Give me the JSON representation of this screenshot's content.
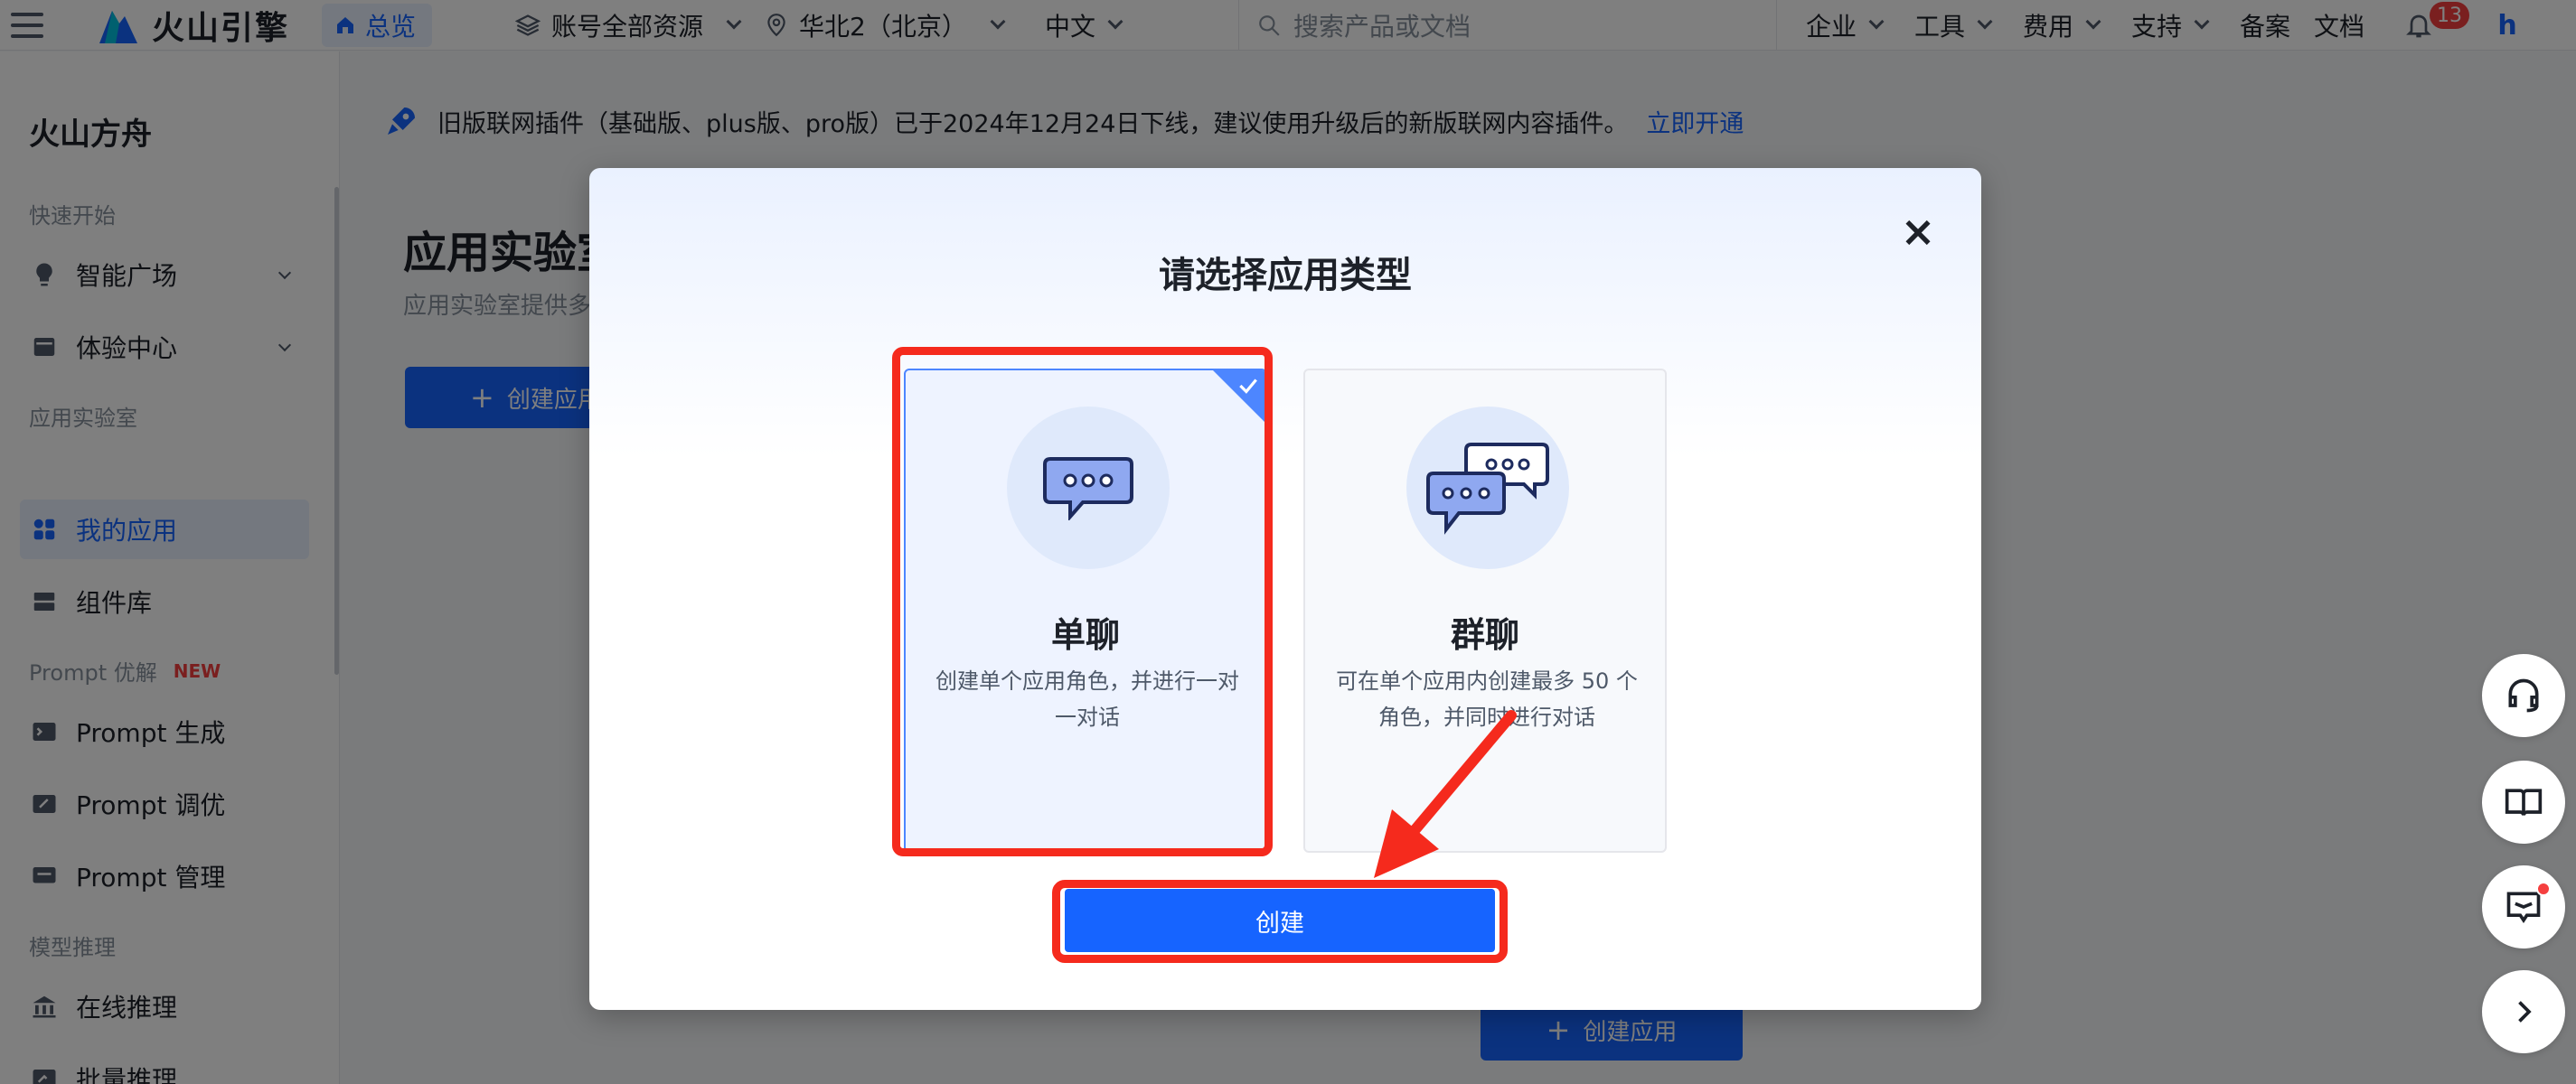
{
  "topbar": {
    "brand": "火山引擎",
    "home": "总览",
    "resource": "账号全部资源",
    "region": "华北2（北京）",
    "language": "中文",
    "search_placeholder": "搜索产品或文档",
    "menu": [
      "企业",
      "工具",
      "费用",
      "支持",
      "备案",
      "文档"
    ],
    "notification_count": "13",
    "avatar_letter": "h"
  },
  "sidebar": {
    "title": "火山方舟",
    "groups": {
      "quick_start": "快速开始",
      "app_lab": "应用实验室",
      "prompt": "Prompt 优解",
      "prompt_tag": "NEW",
      "model_inference": "模型推理"
    },
    "items": {
      "smart_square": "智能广场",
      "experience_center": "体验中心",
      "my_apps": "我的应用",
      "component_lib": "组件库",
      "prompt_gen": "Prompt 生成",
      "prompt_tune": "Prompt 调优",
      "prompt_manage": "Prompt 管理",
      "online_infer": "在线推理",
      "batch_infer": "批量推理"
    }
  },
  "main": {
    "notice_text": "旧版联网插件（基础版、plus版、pro版）已于2024年12月24日下线，建议使用升级后的新版联网内容插件。",
    "notice_link": "立即开通",
    "page_title": "应用实验室",
    "page_subtitle": "应用实验室提供多",
    "create_button": "创建应用",
    "create_button_bottom": "创建应用"
  },
  "modal": {
    "title": "请选择应用类型",
    "close_icon": "×",
    "cards": [
      {
        "title": "单聊",
        "description": "创建单个应用角色，并进行一对一对话",
        "selected": true
      },
      {
        "title": "群聊",
        "description": "可在单个应用内创建最多 50 个角色，并同时进行对话",
        "selected": false
      }
    ],
    "confirm_button": "创建"
  },
  "colors": {
    "accent": "#1664ff",
    "highlight": "#f52a1d",
    "overlay": "rgba(0,0,0,0.5)"
  },
  "icons": {
    "fab": [
      "headset-icon",
      "book-icon",
      "feedback-icon",
      "chevron-right-icon"
    ]
  }
}
